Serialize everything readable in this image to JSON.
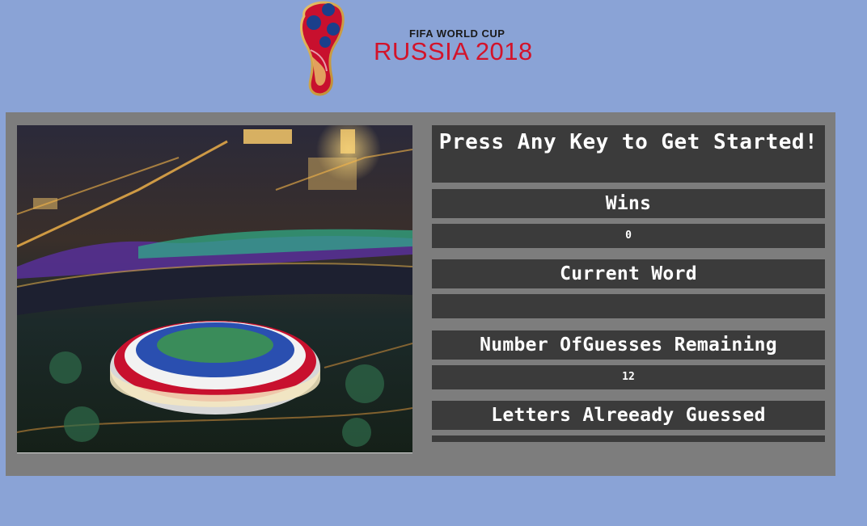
{
  "logo": {
    "small_text": "FIFA WORLD CUP",
    "big_text": "RUSSIA 2018",
    "brand_red": "#d3132a"
  },
  "photo": {
    "description_icon": "stadium-photo"
  },
  "game": {
    "title": "Press Any Key to Get Started!",
    "wins_label": "Wins",
    "wins_value": "0",
    "current_word_label": "Current Word",
    "current_word_value": "__________",
    "guesses_label": "Number OfGuesses Remaining",
    "guesses_value": "12",
    "letters_label": "Letters Alreeady Guessed",
    "letters_value": ""
  },
  "colors": {
    "background": "#8aa3d6",
    "panel": "#7d7d7d",
    "box": "#3b3b3b",
    "text": "#ffffff"
  }
}
